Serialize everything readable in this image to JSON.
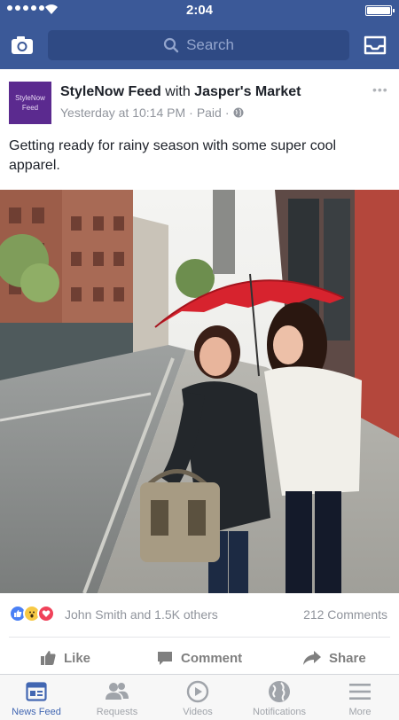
{
  "status_bar": {
    "time": "2:04"
  },
  "nav": {
    "search_placeholder": "Search"
  },
  "post": {
    "author_label": "StyleNow Feed",
    "avatar_text": [
      "StyleNow",
      "Feed"
    ],
    "title_with": "with",
    "partner": "Jasper's Market",
    "timestamp": "Yesterday at 10:14 PM",
    "separator": "·",
    "sponsored_label": "Paid",
    "caption": "Getting ready for rainy season with some super cool apparel.",
    "photo_alt": "Two women walking under a red umbrella on a rainy city street"
  },
  "engagement": {
    "reactions_text": "John Smith and 1.5K others",
    "comments_text": "212 Comments",
    "reaction_icons": [
      "like-icon",
      "wow-icon",
      "love-icon"
    ]
  },
  "actions": {
    "like": "Like",
    "comment": "Comment",
    "share": "Share"
  },
  "tabs": [
    {
      "label": "News Feed",
      "icon": "news-feed-icon",
      "active": true
    },
    {
      "label": "Requests",
      "icon": "friend-requests-icon",
      "active": false
    },
    {
      "label": "Videos",
      "icon": "video-play-icon",
      "active": false
    },
    {
      "label": "Notifications",
      "icon": "globe-icon",
      "active": false
    },
    {
      "label": "More",
      "icon": "hamburger-menu-icon",
      "active": false
    }
  ],
  "colors": {
    "brand_blue": "#3b5998",
    "active_tab": "#4267b2",
    "avatar_purple": "#5b2a8f",
    "umbrella_red": "#d7232e"
  }
}
